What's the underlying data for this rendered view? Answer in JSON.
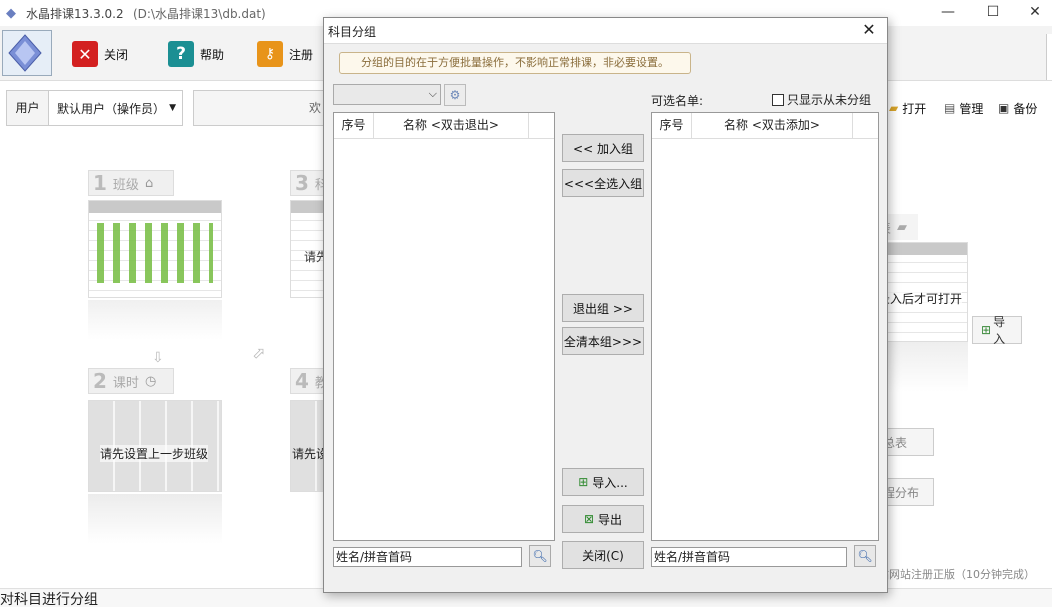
{
  "app": {
    "title": "水晶排课13.3.0.2",
    "path": "(D:\\水晶排课13\\db.dat)",
    "status_text": "对科目进行分组"
  },
  "toolbar": {
    "close_label": "关闭",
    "help_label": "帮助",
    "register_label": "注册"
  },
  "userbar": {
    "label": "用户",
    "value": "默认用户（操作员）",
    "welcome_partial": "欢"
  },
  "right_tools": {
    "open_label": "打开",
    "manage_label": "管理",
    "backup_label": "备份"
  },
  "background": {
    "step1": {
      "num": "1",
      "label": "班级"
    },
    "step2": {
      "num": "2",
      "label": "课时"
    },
    "step3": {
      "num": "3",
      "label": "科"
    },
    "step4": {
      "num": "4",
      "label": "教"
    },
    "step1_hint": "请先",
    "step2_hint": "请先设置上一步班级",
    "step4_hint": "请先设",
    "right_hint": "录入后才可打开",
    "right_tab": "表",
    "import_label": "导入",
    "side_btn1": "总表",
    "side_btn2": "程分布",
    "footer_text": "站网站注册正版（10分钟完成）"
  },
  "dialog": {
    "title": "科目分组",
    "close_icon": "✕",
    "hint": "分组的目的在于方便批量操作，不影响正常排课，非必要设置。",
    "available_label": "可选名单:",
    "only_ungrouped_label": "只显示从未分组",
    "left_list": {
      "col_index": "序号",
      "col_name": "名称 <双击退出>"
    },
    "right_list": {
      "col_index": "序号",
      "col_name": "名称 <双击添加>"
    },
    "add_btn": "<<  加入组",
    "add_all_btn": "<<<全选入组",
    "remove_btn": "退出组  >>",
    "clear_btn": "全清本组>>>",
    "import_btn": "导入...",
    "export_btn": "导出",
    "close_btn": "关闭(C)",
    "search_left_placeholder": "姓名/拼音首码",
    "search_right_placeholder": "姓名/拼音首码"
  }
}
